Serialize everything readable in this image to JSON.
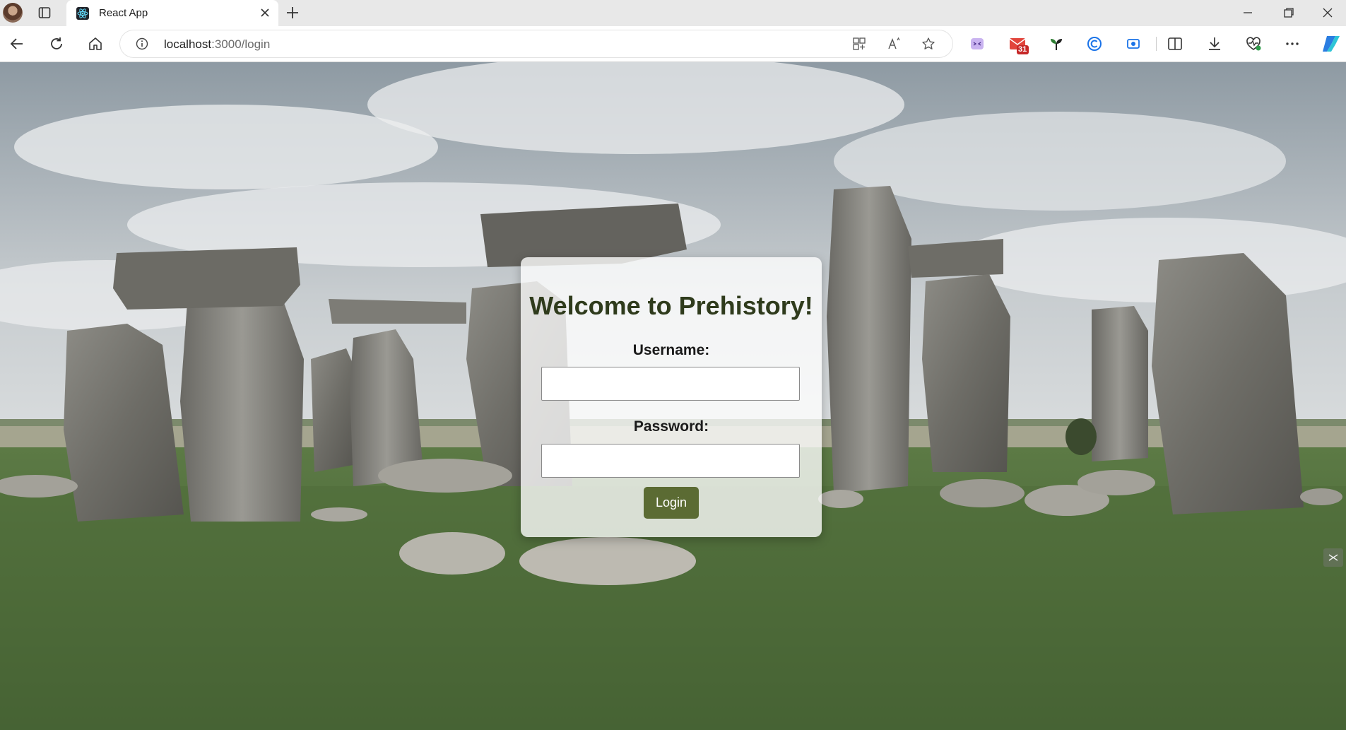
{
  "browser": {
    "tab_title": "React App",
    "url_host": "localhost",
    "url_path": ":3000/login",
    "notification_badge": "31"
  },
  "login": {
    "heading": "Welcome to Prehistory!",
    "username_label": "Username:",
    "username_value": "",
    "password_label": "Password:",
    "password_value": "",
    "submit_label": "Login"
  },
  "colors": {
    "heading": "#2f3b1c",
    "button": "#5b6b33"
  }
}
